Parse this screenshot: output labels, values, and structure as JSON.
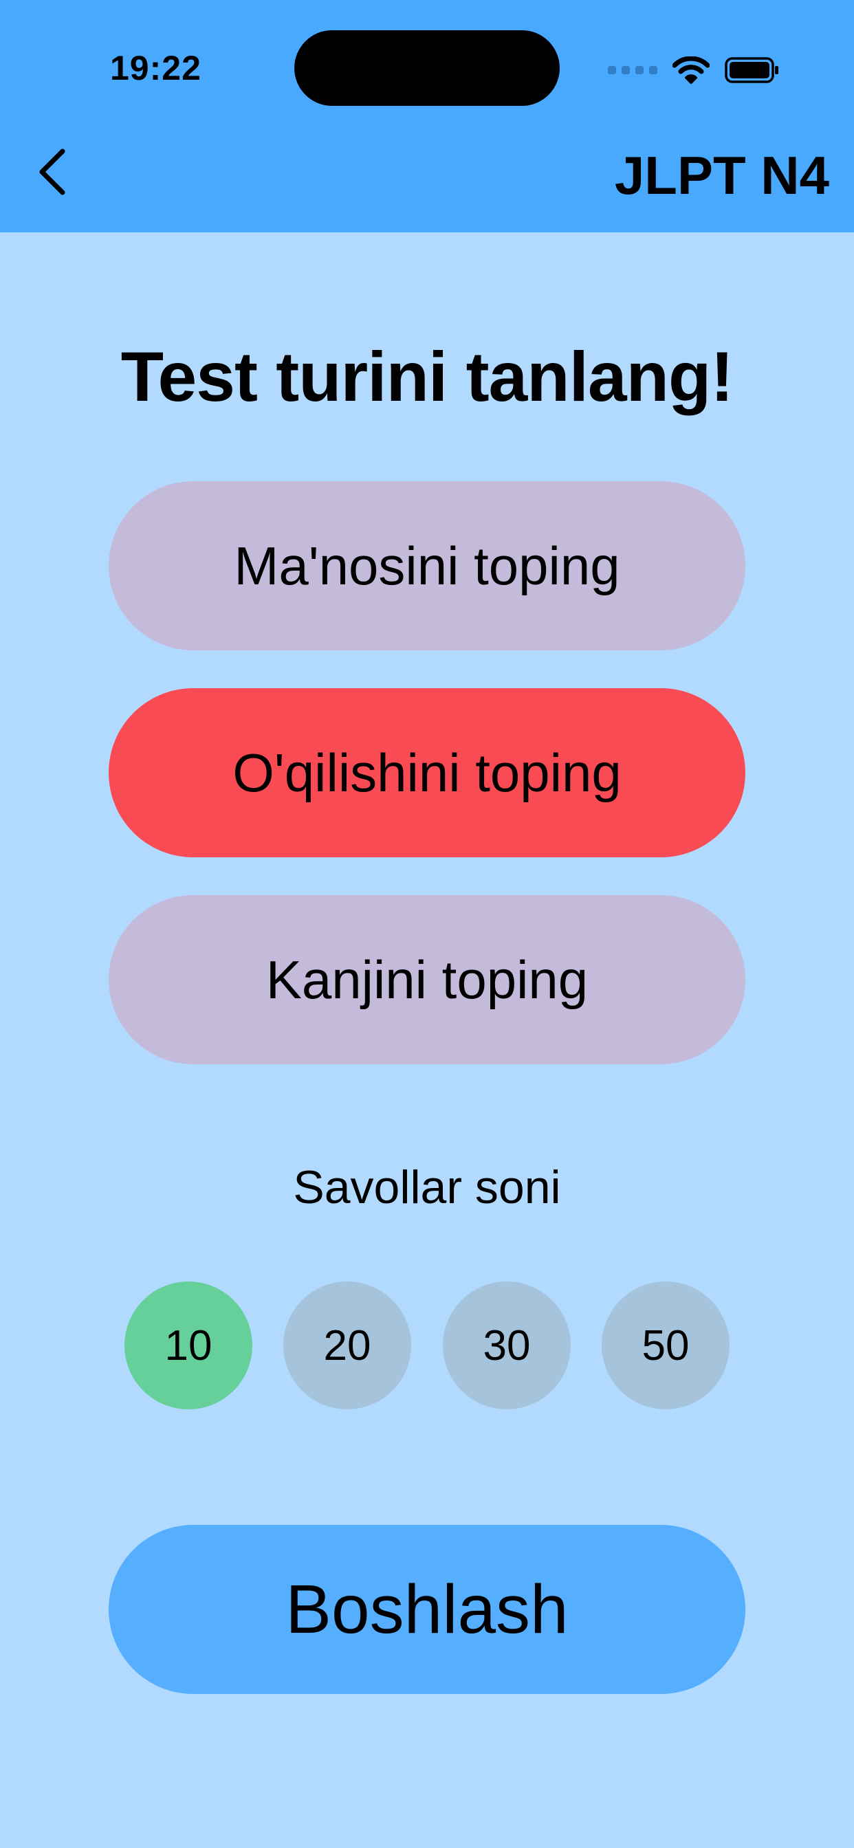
{
  "status_bar": {
    "time": "19:22",
    "icons": [
      "cellular-signal-icon",
      "wifi-icon",
      "battery-icon"
    ]
  },
  "nav": {
    "back_icon": "chevron-left-icon",
    "title": "JLPT N4"
  },
  "heading": "Test turini tanlang!",
  "test_types": [
    {
      "label": "Ma'nosini toping",
      "selected": false
    },
    {
      "label": "O'qilishini toping",
      "selected": true
    },
    {
      "label": "Kanjini toping",
      "selected": false
    }
  ],
  "question_count": {
    "label": "Savollar soni",
    "options": [
      "10",
      "20",
      "30",
      "50"
    ],
    "selected": "10"
  },
  "start_button": "Boshlash",
  "colors": {
    "background": "#b2daff",
    "header": "#48a9fe",
    "option": "#c3bbd9",
    "option_selected": "#f94b54",
    "count": "#a5c3da",
    "count_selected": "#65d09a",
    "start": "#55affe"
  }
}
